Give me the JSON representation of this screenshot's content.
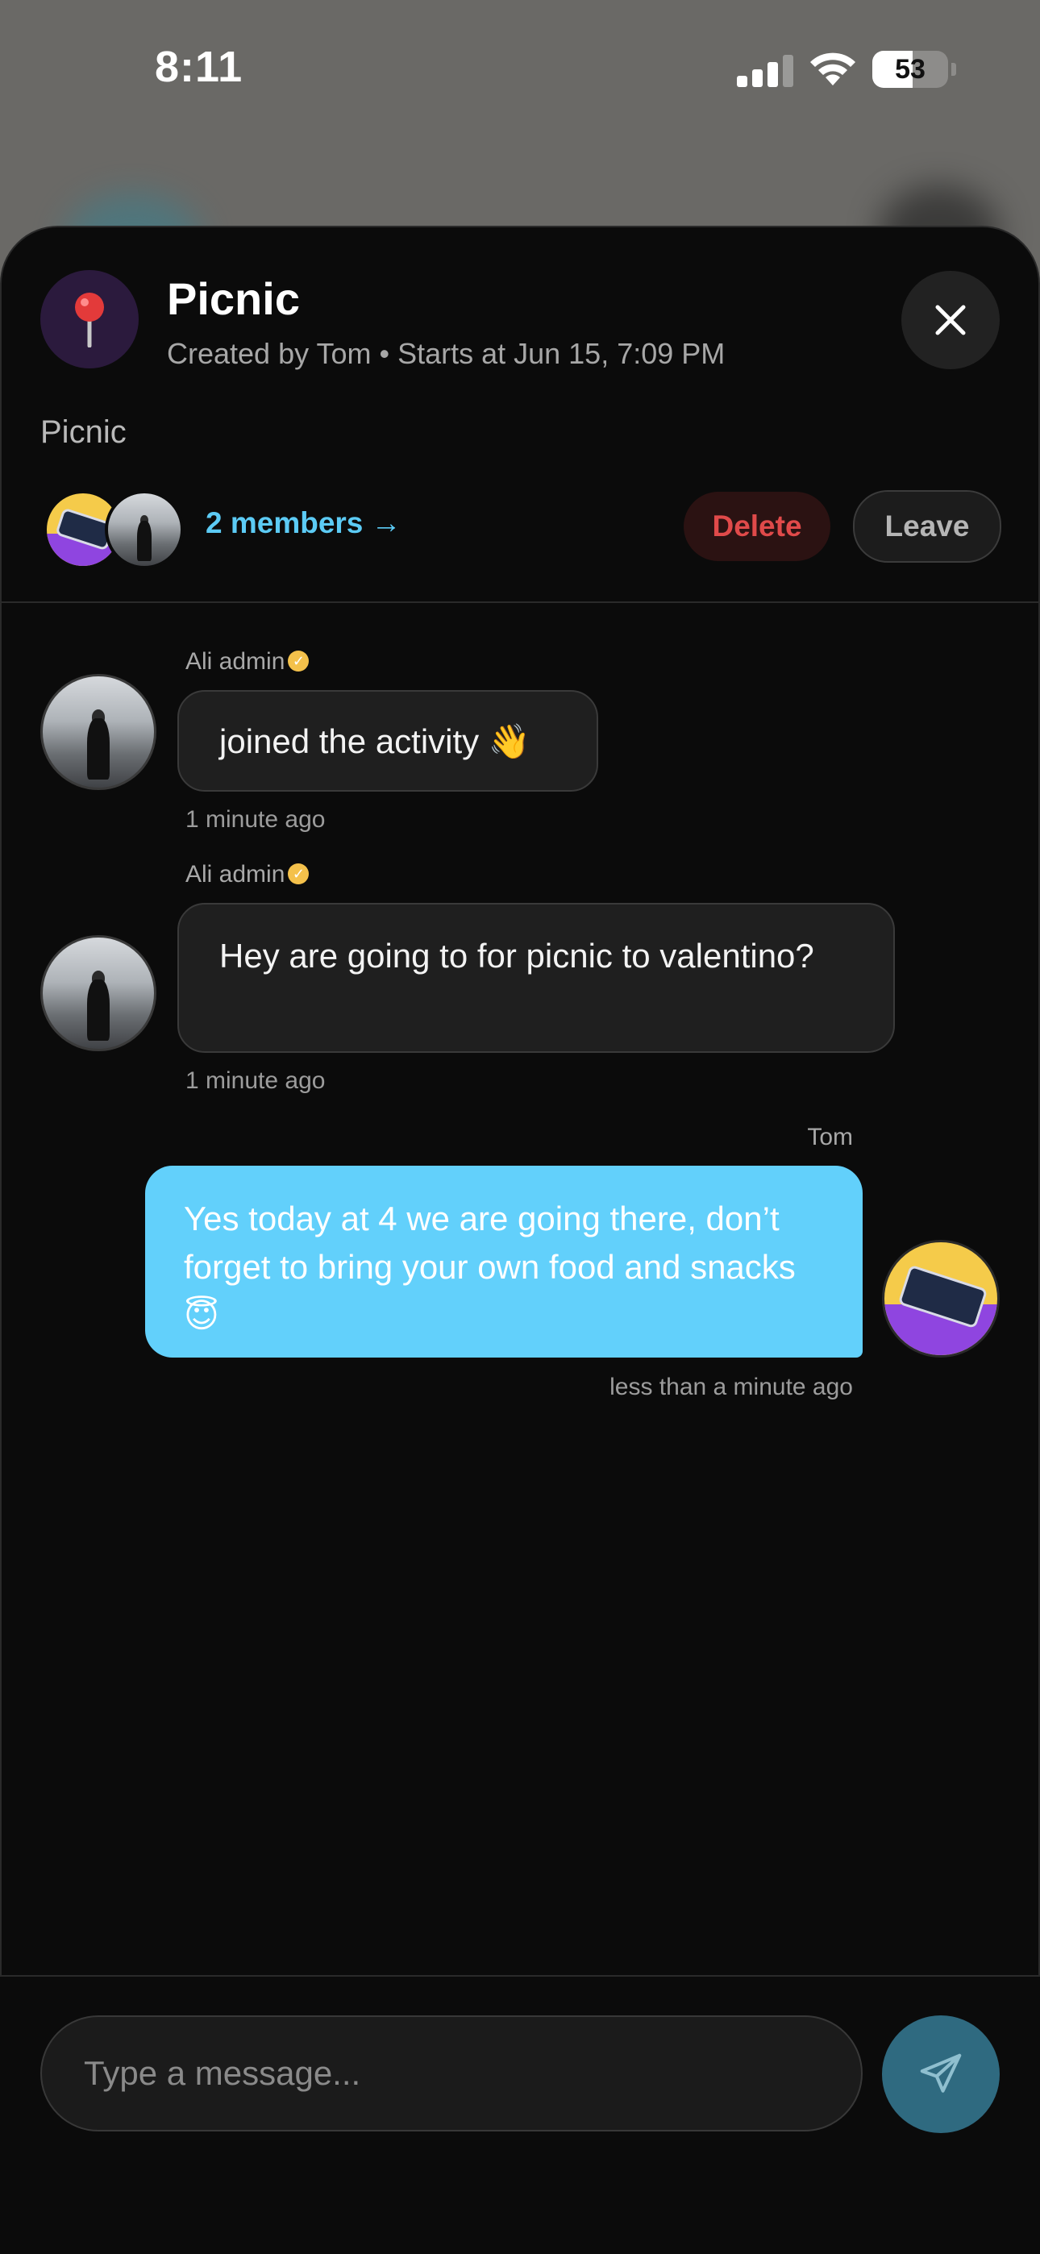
{
  "status_bar": {
    "time": "8:11",
    "battery": "53",
    "battery_level": 0.53
  },
  "event": {
    "icon": "pin-icon",
    "title": "Picnic",
    "subtitle": "Created by Tom • Starts at Jun 15, 7:09 PM",
    "description": "Picnic",
    "members_link": "2 members →",
    "delete_label": "Delete",
    "leave_label": "Leave"
  },
  "messages": [
    {
      "sender": "Ali admin",
      "verified": true,
      "text": "joined the activity 👋",
      "time": "1 minute ago",
      "side": "left"
    },
    {
      "sender": "Ali admin",
      "verified": true,
      "text": "Hey are going to for picnic to valentino?",
      "time": "1 minute ago",
      "side": "left"
    },
    {
      "sender": "Tom",
      "verified": false,
      "text": "Yes today at 4 we are going there, don’t forget to bring your own food and snacks 😇",
      "time": "less than a minute ago",
      "side": "right"
    }
  ],
  "composer": {
    "placeholder": "Type a message..."
  },
  "colors": {
    "accent": "#62d0fb",
    "danger": "#e04a4a",
    "send": "#2f6a80",
    "sheet": "#0b0b0b"
  }
}
